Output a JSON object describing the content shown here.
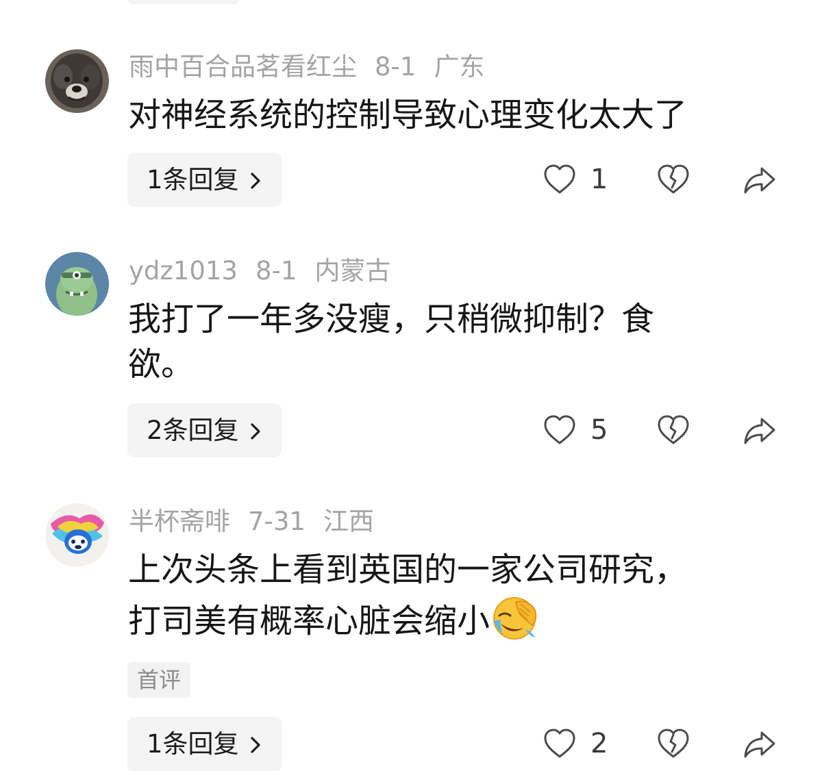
{
  "comments": [
    {
      "username": "雨中百合品茗看红尘",
      "date": "8-1",
      "location": "广东",
      "text": "对神经系统的控制导致心理变化太大了",
      "replies_label": "1条回复",
      "likes": "1",
      "avatar_icon": "dog-photo-avatar"
    },
    {
      "username": "ydz1013",
      "date": "8-1",
      "location": "内蒙古",
      "text": "我打了一年多没瘦，只稍微抑制？食\n欲。",
      "replies_label": "2条回复",
      "likes": "5",
      "avatar_icon": "green-cartoon-avatar"
    },
    {
      "username": "半杯斋啡",
      "date": "7-31",
      "location": "江西",
      "text": "上次头条上看到英国的一家公司研究，\n打司美有概率心脏会缩小",
      "emoji_icon": "face-with-tears-of-joy-covering-emoji",
      "tag": "首评",
      "replies_label": "1条回复",
      "likes": "2",
      "avatar_icon": "colorful-splash-avatar"
    }
  ],
  "icons": {
    "like": "heart-outline-icon",
    "dislike": "broken-heart-icon",
    "share": "share-arrow-icon",
    "chevron": "chevron-right-icon"
  },
  "colors": {
    "meta_text": "#a4a4a4",
    "body_text": "#161616",
    "button_bg": "#f4f4f4",
    "icon_stroke": "#4a4a4a"
  }
}
